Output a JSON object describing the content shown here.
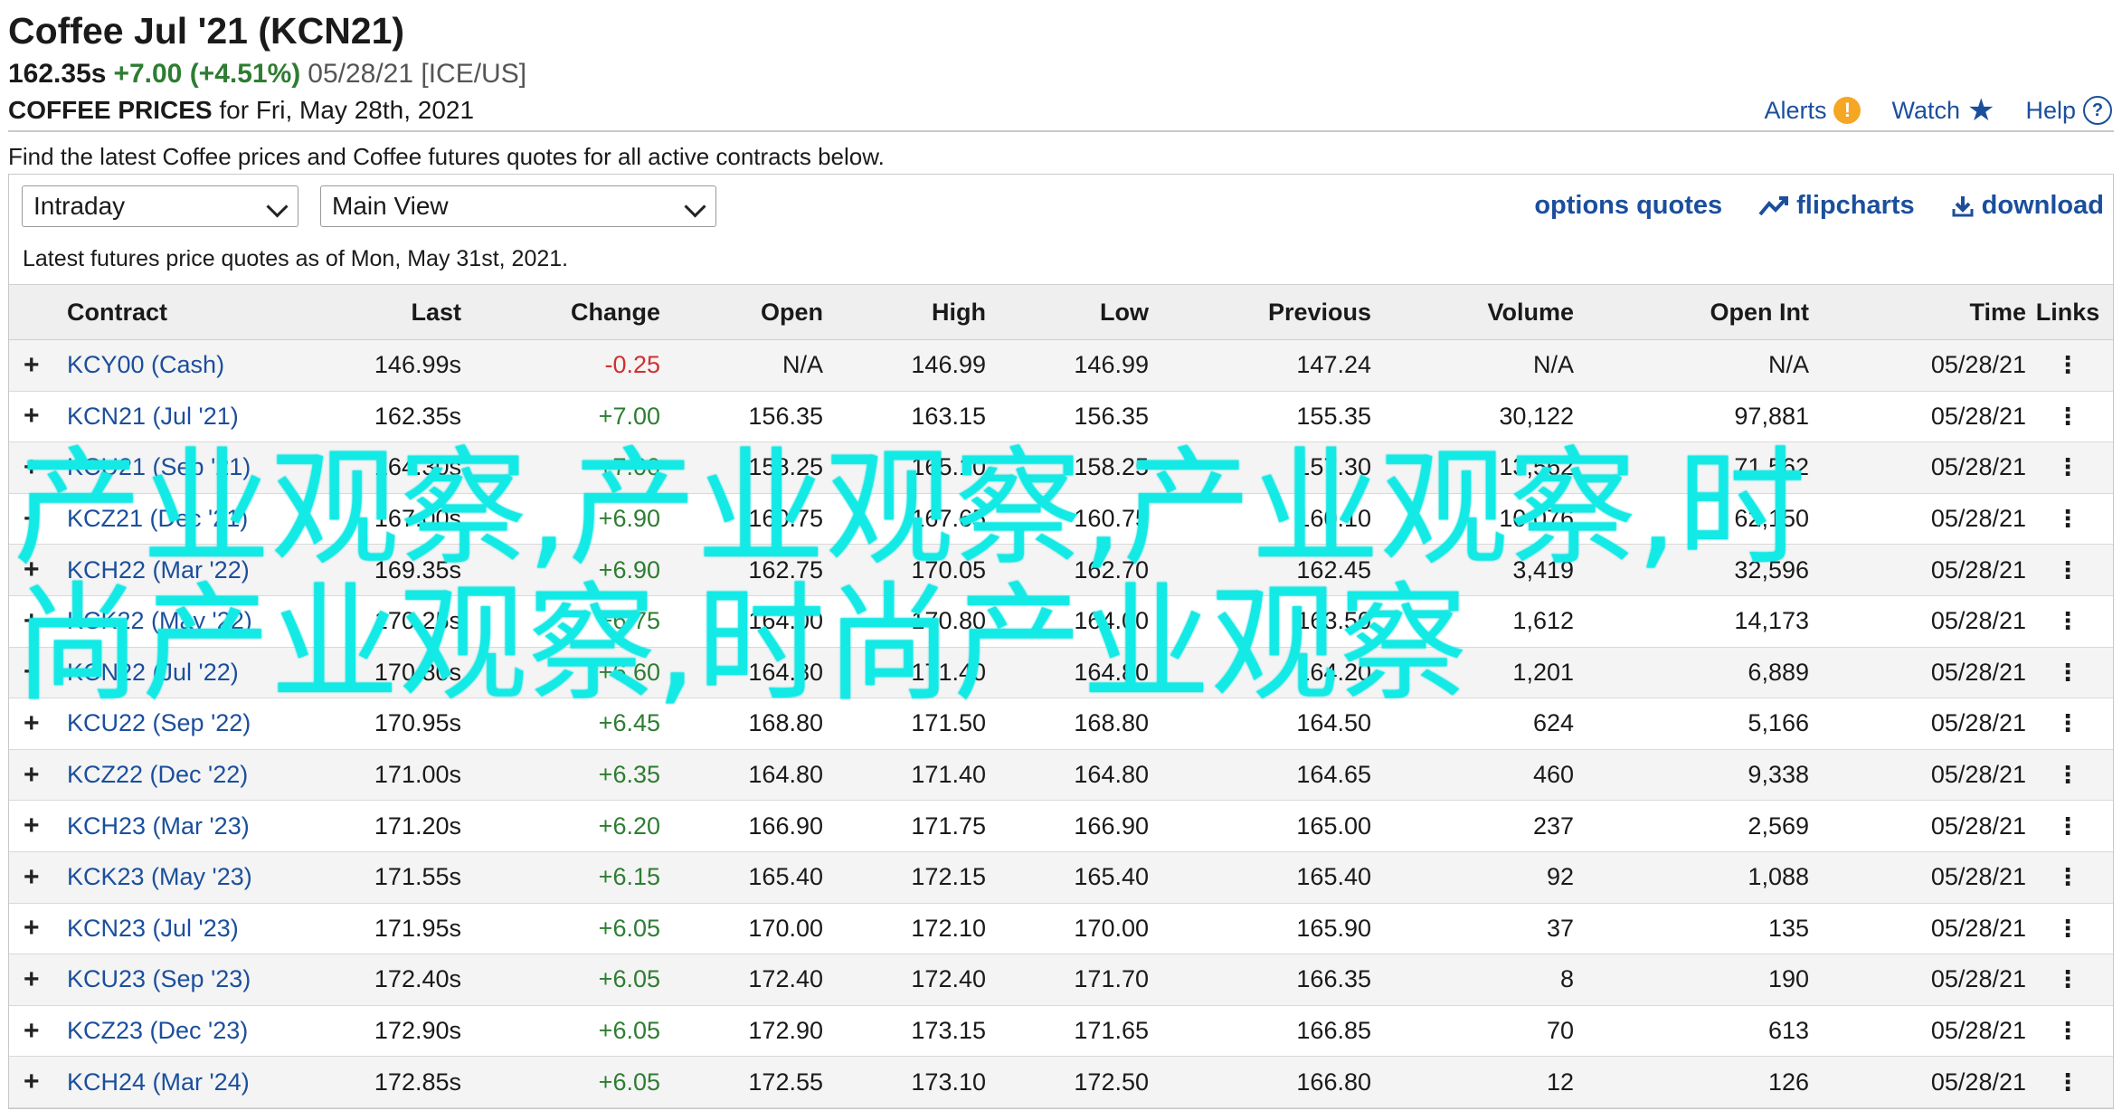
{
  "header": {
    "title": "Coffee Jul '21 (KCN21)",
    "last_price": "162.35s",
    "change": "+7.00 (+4.51%)",
    "date_exchange": "05/28/21 [ICE/US]",
    "section_label": "COFFEE PRICES",
    "section_date": "for Fri, May 28th, 2021",
    "links": {
      "alerts": "Alerts",
      "watch": "Watch",
      "help": "Help"
    }
  },
  "intro_text": "Find the latest Coffee prices and Coffee futures quotes for all active contracts below.",
  "controls": {
    "period_select": "Intraday",
    "view_select": "Main View",
    "links": {
      "options": "options quotes",
      "flipcharts": "flipcharts",
      "download": "download"
    }
  },
  "as_of_text": "Latest futures price quotes as of Mon, May 31st, 2021.",
  "table": {
    "headers": [
      "Contract",
      "Last",
      "Change",
      "Open",
      "High",
      "Low",
      "Previous",
      "Volume",
      "Open Int",
      "Time",
      "Links"
    ],
    "rows": [
      {
        "contract": "KCY00 (Cash)",
        "last": "146.99s",
        "change": "-0.25",
        "open": "N/A",
        "high": "146.99",
        "low": "146.99",
        "previous": "147.24",
        "volume": "N/A",
        "open_int": "N/A",
        "time": "05/28/21"
      },
      {
        "contract": "KCN21 (Jul '21)",
        "last": "162.35s",
        "change": "+7.00",
        "open": "156.35",
        "high": "163.15",
        "low": "156.35",
        "previous": "155.35",
        "volume": "30,122",
        "open_int": "97,881",
        "time": "05/28/21"
      },
      {
        "contract": "KCU21 (Sep '21)",
        "last": "164.30s",
        "change": "+7.00",
        "open": "158.25",
        "high": "165.10",
        "low": "158.25",
        "previous": "157.30",
        "volume": "13,562",
        "open_int": "71,562",
        "time": "05/28/21"
      },
      {
        "contract": "KCZ21 (Dec '21)",
        "last": "167.00s",
        "change": "+6.90",
        "open": "160.75",
        "high": "167.65",
        "low": "160.75",
        "previous": "160.10",
        "volume": "10,076",
        "open_int": "62,150",
        "time": "05/28/21"
      },
      {
        "contract": "KCH22 (Mar '22)",
        "last": "169.35s",
        "change": "+6.90",
        "open": "162.75",
        "high": "170.05",
        "low": "162.70",
        "previous": "162.45",
        "volume": "3,419",
        "open_int": "32,596",
        "time": "05/28/21"
      },
      {
        "contract": "KCK22 (May '22)",
        "last": "170.25s",
        "change": "+6.75",
        "open": "164.00",
        "high": "170.80",
        "low": "164.00",
        "previous": "163.50",
        "volume": "1,612",
        "open_int": "14,173",
        "time": "05/28/21"
      },
      {
        "contract": "KCN22 (Jul '22)",
        "last": "170.80s",
        "change": "+6.60",
        "open": "164.80",
        "high": "171.40",
        "low": "164.80",
        "previous": "164.20",
        "volume": "1,201",
        "open_int": "6,889",
        "time": "05/28/21"
      },
      {
        "contract": "KCU22 (Sep '22)",
        "last": "170.95s",
        "change": "+6.45",
        "open": "168.80",
        "high": "171.50",
        "low": "168.80",
        "previous": "164.50",
        "volume": "624",
        "open_int": "5,166",
        "time": "05/28/21"
      },
      {
        "contract": "KCZ22 (Dec '22)",
        "last": "171.00s",
        "change": "+6.35",
        "open": "164.80",
        "high": "171.40",
        "low": "164.80",
        "previous": "164.65",
        "volume": "460",
        "open_int": "9,338",
        "time": "05/28/21"
      },
      {
        "contract": "KCH23 (Mar '23)",
        "last": "171.20s",
        "change": "+6.20",
        "open": "166.90",
        "high": "171.75",
        "low": "166.90",
        "previous": "165.00",
        "volume": "237",
        "open_int": "2,569",
        "time": "05/28/21"
      },
      {
        "contract": "KCK23 (May '23)",
        "last": "171.55s",
        "change": "+6.15",
        "open": "165.40",
        "high": "172.15",
        "low": "165.40",
        "previous": "165.40",
        "volume": "92",
        "open_int": "1,088",
        "time": "05/28/21"
      },
      {
        "contract": "KCN23 (Jul '23)",
        "last": "171.95s",
        "change": "+6.05",
        "open": "170.00",
        "high": "172.10",
        "low": "170.00",
        "previous": "165.90",
        "volume": "37",
        "open_int": "135",
        "time": "05/28/21"
      },
      {
        "contract": "KCU23 (Sep '23)",
        "last": "172.40s",
        "change": "+6.05",
        "open": "172.40",
        "high": "172.40",
        "low": "171.70",
        "previous": "166.35",
        "volume": "8",
        "open_int": "190",
        "time": "05/28/21"
      },
      {
        "contract": "KCZ23 (Dec '23)",
        "last": "172.90s",
        "change": "+6.05",
        "open": "172.90",
        "high": "173.15",
        "low": "171.65",
        "previous": "166.85",
        "volume": "70",
        "open_int": "613",
        "time": "05/28/21"
      },
      {
        "contract": "KCH24 (Mar '24)",
        "last": "172.85s",
        "change": "+6.05",
        "open": "172.55",
        "high": "173.10",
        "low": "172.50",
        "previous": "166.80",
        "volume": "12",
        "open_int": "126",
        "time": "05/28/21"
      }
    ]
  },
  "watermark_text": "产业观察,产业观察,产业观察,时尚产业观察,时尚产业观察",
  "colors": {
    "link": "#1b4f9c",
    "positive": "#2e7d32",
    "negative": "#d32f2f",
    "watermark": "#13eae6"
  },
  "icons": {
    "alerts": "exclamation-circle-icon",
    "watch": "star-icon",
    "help": "question-circle-icon",
    "flipcharts": "trend-chart-icon",
    "download": "download-icon",
    "row_expand": "plus-icon",
    "row_links": "kebab-menu-icon"
  }
}
